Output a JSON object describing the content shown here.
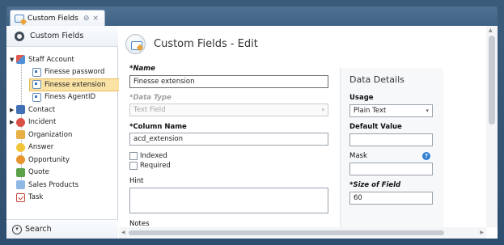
{
  "tab": {
    "title": "Custom Fields",
    "pin_glyph": "⊘",
    "close_glyph": "×",
    "icon": "custom-fields-icon"
  },
  "nav": {
    "header_label": "Custom Fields",
    "tree": [
      {
        "label": "Staff Account",
        "level": 0,
        "expanded": true,
        "icon": "staff-account-icon"
      },
      {
        "label": "Finesse password",
        "level": 1,
        "icon": "field-icon"
      },
      {
        "label": "Finesse extension",
        "level": 1,
        "selected": true,
        "icon": "field-icon"
      },
      {
        "label": "Finess AgentID",
        "level": 1,
        "icon": "field-icon"
      },
      {
        "label": "Contact",
        "level": 0,
        "expanded": false,
        "icon": "contact-icon"
      },
      {
        "label": "Incident",
        "level": 0,
        "expanded": false,
        "icon": "incident-icon"
      },
      {
        "label": "Organization",
        "level": 0,
        "icon": "organization-icon"
      },
      {
        "label": "Answer",
        "level": 0,
        "icon": "answer-icon"
      },
      {
        "label": "Opportunity",
        "level": 0,
        "icon": "opportunity-icon"
      },
      {
        "label": "Quote",
        "level": 0,
        "icon": "quote-icon"
      },
      {
        "label": "Sales Products",
        "level": 0,
        "icon": "sales-products-icon"
      },
      {
        "label": "Task",
        "level": 0,
        "icon": "task-icon"
      }
    ],
    "footer_label": "Search"
  },
  "form": {
    "title": "Custom Fields - Edit",
    "name_label": "*Name",
    "name_value": "Finesse extension",
    "data_type_label": "*Data Type",
    "data_type_value": "Text Field",
    "column_name_label": "*Column Name",
    "column_name_value": "acd_extension",
    "indexed_label": "Indexed",
    "required_label": "Required",
    "hint_label": "Hint",
    "notes_label": "Notes"
  },
  "details": {
    "title": "Data Details",
    "usage_label": "Usage",
    "usage_value": "Plain Text",
    "default_value_label": "Default Value",
    "default_value": "",
    "mask_label": "Mask",
    "mask_value": "",
    "size_label": "*Size of Field",
    "size_value": "60"
  },
  "colors": {
    "frame": "#2e4f70",
    "selected_row": "#fbe3a6",
    "help_icon": "#2f7fd1"
  }
}
